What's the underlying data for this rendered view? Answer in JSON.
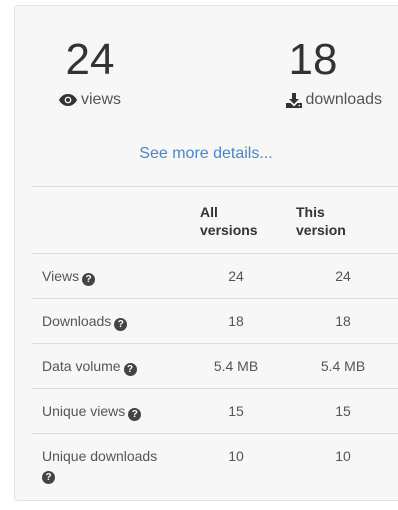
{
  "summary": {
    "views_count": "24",
    "views_label": "views",
    "downloads_count": "18",
    "downloads_label": "downloads",
    "details_link": "See more details..."
  },
  "table": {
    "headers": [
      "",
      "All versions",
      "This version"
    ],
    "header_all_line1": "All",
    "header_all_line2": "versions",
    "header_this_line1": "This",
    "header_this_line2": "version",
    "rows": [
      {
        "label": "Views",
        "all": "24",
        "this": "24"
      },
      {
        "label": "Downloads",
        "all": "18",
        "this": "18"
      },
      {
        "label": "Data volume",
        "all": "5.4 MB",
        "this": "5.4 MB"
      },
      {
        "label": "Unique views",
        "all": "15",
        "this": "15"
      },
      {
        "label": "Unique downloads",
        "all": "10",
        "this": "10"
      }
    ]
  },
  "icons": {
    "views": "eye-icon",
    "downloads": "download-icon",
    "help": "question-circle-icon"
  },
  "colors": {
    "link": "#4a86c7",
    "panel_bg": "#f7f7f7",
    "border": "#dddddd"
  }
}
